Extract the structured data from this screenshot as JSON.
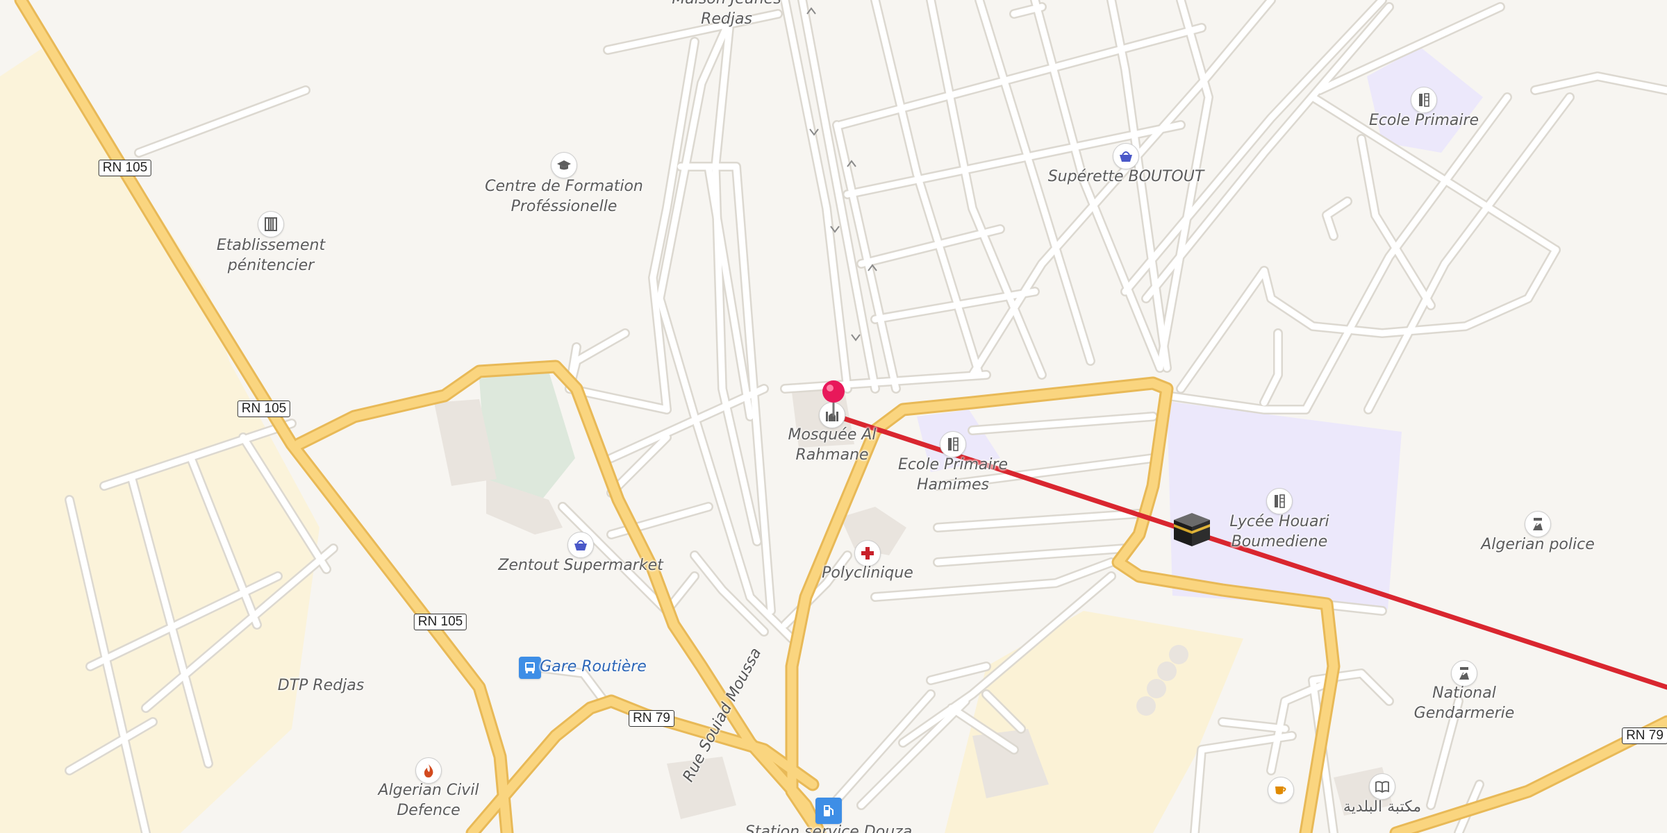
{
  "map": {
    "colors": {
      "background": "#f7f5f1",
      "major_road": "#fad57f",
      "major_road_casing": "#e8b957",
      "minor_road": "#ffffff",
      "minor_road_casing": "#dcd8d0",
      "landuse_yellow": "#fbf2d6",
      "school_area": "#ece8fb",
      "building": "#e9e4de",
      "park": "#dde8dc",
      "route_line": "#d9262f",
      "pin": "#e8185a"
    },
    "route_shields": {
      "rn105_a": "RN 105",
      "rn105_b": "RN 105",
      "rn105_c": "RN 105",
      "rn79_a": "RN 79",
      "rn79_b": "RN 79"
    },
    "street_labels": {
      "rue_souiad": "Rue Souiad Moussa"
    },
    "places": {
      "maison_jeunes": "Maison Jeunes\nRedjas",
      "centre_formation": "Centre de Formation\nProféssionelle",
      "etablissement": "Etablissement\npénitencier",
      "superette": "Supérette BOUTOUT",
      "ecole_primaire_ne": "Ecole Primaire",
      "mosquee": "Mosquée Al\nRahmane",
      "ecole_hamimes": "Ecole Primaire\nHamimes",
      "lycee": "Lycée Houari\nBoumediene",
      "algerian_police": "Algerian police",
      "zentout": "Zentout Supermarket",
      "polyclinique": "Polyclinique",
      "gare": "Gare Routière",
      "dtp": "DTP Redjas",
      "national_gendarmerie": "National\nGendarmerie",
      "algerian_civil": "Algerian Civil\nDefence",
      "station": "Station service Douza",
      "bibliotheque": "مكتبة البلدية"
    },
    "icons": {
      "centre_formation": "graduation-cap-icon",
      "etablissement": "prison-icon",
      "superette": "shopping-basket-icon",
      "ecole_primaire_ne": "school-icon",
      "mosquee": "mosque-icon",
      "ecole_hamimes": "school-icon",
      "lycee": "school-icon",
      "algerian_police": "police-icon",
      "zentout": "shopping-basket-icon",
      "polyclinique": "medical-cross-icon",
      "gare": "bus-icon",
      "national_gendarmerie": "police-icon",
      "algerian_civil": "fire-icon",
      "station": "fuel-icon",
      "cafe": "cafe-icon",
      "bibliotheque": "library-icon",
      "qibla_target": "kaaba-icon",
      "selected_location": "location-pin-icon"
    }
  }
}
